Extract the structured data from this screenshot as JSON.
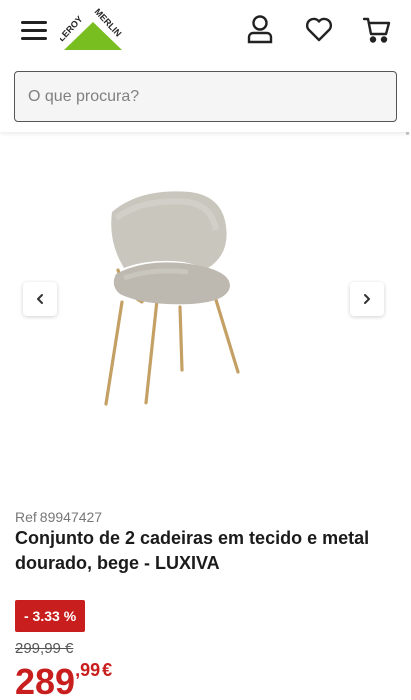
{
  "header": {
    "brand": "LEROY MERLIN",
    "brand_word_1": "LEROY",
    "brand_word_2": "MERLIN",
    "brand_color": "#78be20",
    "icons": [
      "menu-icon",
      "user-icon",
      "heart-icon",
      "cart-icon"
    ]
  },
  "search": {
    "placeholder": "O que procura?"
  },
  "gallery": {
    "prev_icon": "chevron-left-icon",
    "next_icon": "chevron-right-icon"
  },
  "product": {
    "ref_label": "Ref",
    "ref_number": "89947427",
    "title": "Conjunto de 2 cadeiras em tecido e metal dourado, bege - LUXIVA",
    "discount": "- 3.33 %",
    "old_price": "299,99 €",
    "price_integer": "289",
    "price_decimal": ",99",
    "currency": "€",
    "price_color": "#c81e1e"
  }
}
